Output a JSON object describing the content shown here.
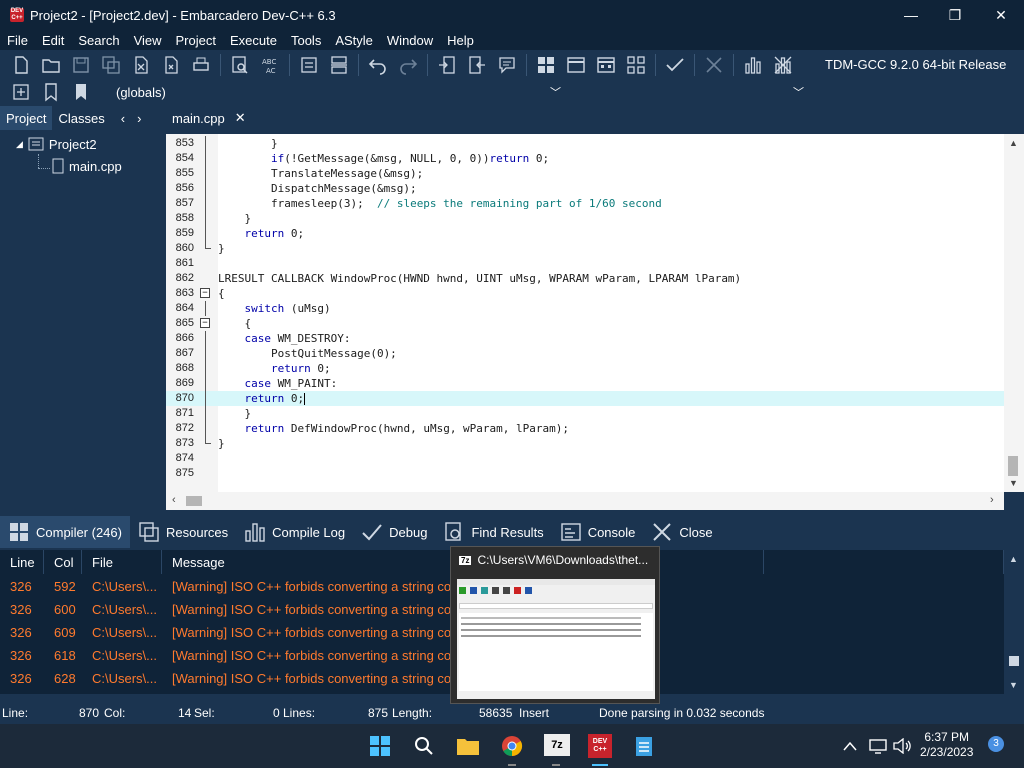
{
  "window": {
    "title": "Project2 - [Project2.dev] - Embarcadero Dev-C++ 6.3",
    "app_icon": "DEV C++"
  },
  "menu": [
    "File",
    "Edit",
    "Search",
    "View",
    "Project",
    "Execute",
    "Tools",
    "AStyle",
    "Window",
    "Help"
  ],
  "compiler": "TDM-GCC 9.2.0 64-bit Release",
  "globals": "(globals)",
  "left_tabs": {
    "project": "Project",
    "classes": "Classes"
  },
  "tree": {
    "project": "Project2",
    "file": "main.cpp"
  },
  "editor_tab": "main.cpp",
  "code_lines": [
    {
      "n": "853",
      "text": "        }"
    },
    {
      "n": "854",
      "text": "        if(!GetMessage(&msg, NULL, 0, 0))return 0;"
    },
    {
      "n": "855",
      "text": "        TranslateMessage(&msg);"
    },
    {
      "n": "856",
      "text": "        DispatchMessage(&msg);"
    },
    {
      "n": "857",
      "text": "        framesleep(3);  ",
      "comment": "// sleeps the remaining part of 1/60 second"
    },
    {
      "n": "858",
      "text": "    }"
    },
    {
      "n": "859",
      "text": "    return 0;"
    },
    {
      "n": "860",
      "text": "}"
    },
    {
      "n": "861",
      "text": ""
    },
    {
      "n": "862",
      "text": "LRESULT CALLBACK WindowProc(HWND hwnd, UINT uMsg, WPARAM wParam, LPARAM lParam)"
    },
    {
      "n": "863",
      "text": "{"
    },
    {
      "n": "864",
      "text": "    switch (uMsg)"
    },
    {
      "n": "865",
      "text": "    {"
    },
    {
      "n": "866",
      "text": "    case WM_DESTROY:"
    },
    {
      "n": "867",
      "text": "        PostQuitMessage(0);"
    },
    {
      "n": "868",
      "text": "        return 0;"
    },
    {
      "n": "869",
      "text": "    case WM_PAINT:"
    },
    {
      "n": "870",
      "text": "    return 0;"
    },
    {
      "n": "871",
      "text": "    }"
    },
    {
      "n": "872",
      "text": "    return DefWindowProc(hwnd, uMsg, wParam, lParam);"
    },
    {
      "n": "873",
      "text": "}"
    },
    {
      "n": "874",
      "text": ""
    },
    {
      "n": "875",
      "text": ""
    }
  ],
  "bottom_tabs": [
    "Compiler (246)",
    "Resources",
    "Compile Log",
    "Debug",
    "Find Results",
    "Console",
    "Close"
  ],
  "grid_headers": [
    "Line",
    "Col",
    "File",
    "Message"
  ],
  "grid_rows": [
    {
      "line": "326",
      "col": "592",
      "file": "C:\\Users\\...",
      "message": "[Warning] ISO C++ forbids converting a string con"
    },
    {
      "line": "326",
      "col": "600",
      "file": "C:\\Users\\...",
      "message": "[Warning] ISO C++ forbids converting a string con"
    },
    {
      "line": "326",
      "col": "609",
      "file": "C:\\Users\\...",
      "message": "[Warning] ISO C++ forbids converting a string con"
    },
    {
      "line": "326",
      "col": "618",
      "file": "C:\\Users\\...",
      "message": "[Warning] ISO C++ forbids converting a string con"
    },
    {
      "line": "326",
      "col": "628",
      "file": "C:\\Users\\...",
      "message": "[Warning] ISO C++ forbids converting a string con"
    }
  ],
  "status": {
    "line_label": "Line:",
    "line_value": "870",
    "col_label": "Col:",
    "col_value": "14",
    "sel_label": "Sel:",
    "sel_value": "0",
    "lines_label": "Lines:",
    "lines_value": "875",
    "length_label": "Length:",
    "length_value": "58635",
    "mode": "Insert",
    "message": "Done parsing in 0.032 seconds"
  },
  "popup": {
    "app_icon": "7z",
    "title": "C:\\Users\\VM6\\Downloads\\thet..."
  },
  "taskbar": {
    "time": "6:37 PM",
    "date": "2/23/2023",
    "badge": "3",
    "icon_7z": "7z",
    "icon_dev": "DEV C++"
  },
  "colors": {
    "accent": "#1b3450",
    "warning": "#ff7a2e",
    "highlight": "#d7f7fa"
  }
}
